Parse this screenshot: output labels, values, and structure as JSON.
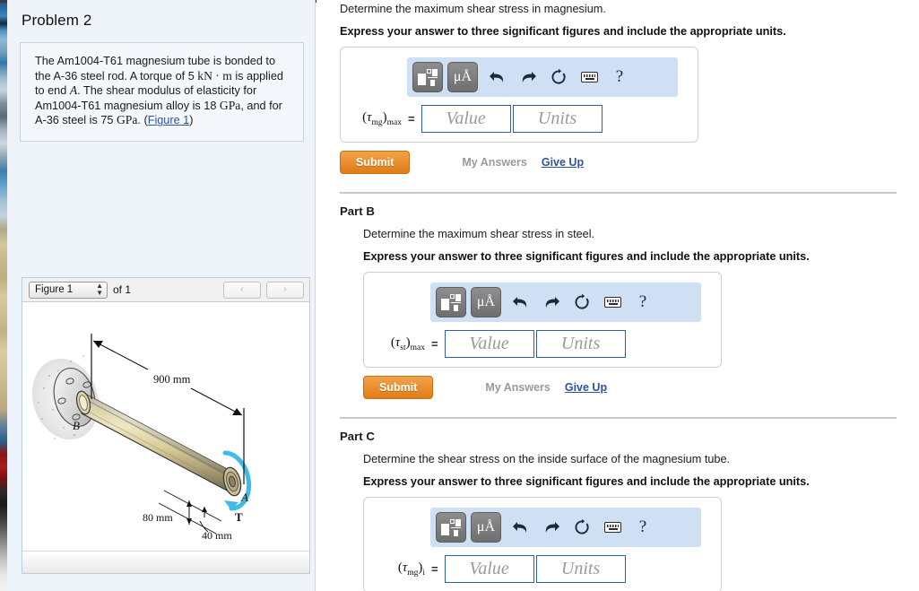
{
  "problem": {
    "title": "Problem 2",
    "statement_parts": [
      {
        "t": "The Am1004-T61 magnesium tube is bonded to the A-36 steel rod. A torque of 5 ",
        "style": "plain"
      },
      {
        "t": "kN · m",
        "style": "serif"
      },
      {
        "t": " is applied to end ",
        "style": "plain"
      },
      {
        "t": "A",
        "style": "italic"
      },
      {
        "t": ". The shear modulus of elasticity for Am1004-T61 magnesium alloy is 18 ",
        "style": "plain"
      },
      {
        "t": "GPa",
        "style": "serif"
      },
      {
        "t": ", and for A-36 steel is 75 ",
        "style": "plain"
      },
      {
        "t": "GPa",
        "style": "serif"
      },
      {
        "t": ". (",
        "style": "plain"
      }
    ],
    "figure_link": "Figure 1",
    "statement_tail": ")"
  },
  "figure_panel": {
    "selected_figure": "Figure 1",
    "of_label": "of 1",
    "prev_label": "‹",
    "next_label": "›",
    "diagram": {
      "dim_length": "900 mm",
      "dim_outer": "80 mm",
      "dim_inner": "40 mm",
      "label_a": "A",
      "label_b": "B",
      "label_torque": "T"
    }
  },
  "mathbar": {
    "template_icon": "template-icon",
    "units_label": "μÅ",
    "undo_icon": "undo-icon",
    "redo_icon": "redo-icon",
    "reset_icon": "reset-icon",
    "keyboard_icon": "keyboard-icon",
    "help_label": "?"
  },
  "fields": {
    "value_placeholder": "Value",
    "units_placeholder": "Units",
    "equals": "="
  },
  "actions": {
    "submit_label": "Submit",
    "my_answers_label": "My Answers",
    "give_up_label": "Give Up"
  },
  "parts": [
    {
      "heading": "",
      "prompt": "Determine the maximum shear stress in magnesium.",
      "bold_prompt": "Express your answer to three significant figures and include the appropriate units.",
      "symbol_base": "τ",
      "symbol_sub": "mg",
      "symbol_outer_sub": "max"
    },
    {
      "heading": "Part B",
      "prompt": "Determine the maximum shear stress in steel.",
      "bold_prompt": "Express your answer to three significant figures and include the appropriate units.",
      "symbol_base": "τ",
      "symbol_sub": "st",
      "symbol_outer_sub": "max"
    },
    {
      "heading": "Part C",
      "prompt": "Determine the shear stress on the inside surface of the magnesium tube.",
      "bold_prompt": "Express your answer to three significant figures and include the appropriate units.",
      "symbol_base": "τ",
      "symbol_sub": "mg",
      "symbol_outer_sub": "i"
    }
  ],
  "colors": {
    "accent_orange": "#e07c17",
    "link_blue": "#2d52a0",
    "mathbar_blue": "#cfe0f5",
    "panel_bg": "#eef4fa",
    "field_border": "#2f5fa8"
  }
}
